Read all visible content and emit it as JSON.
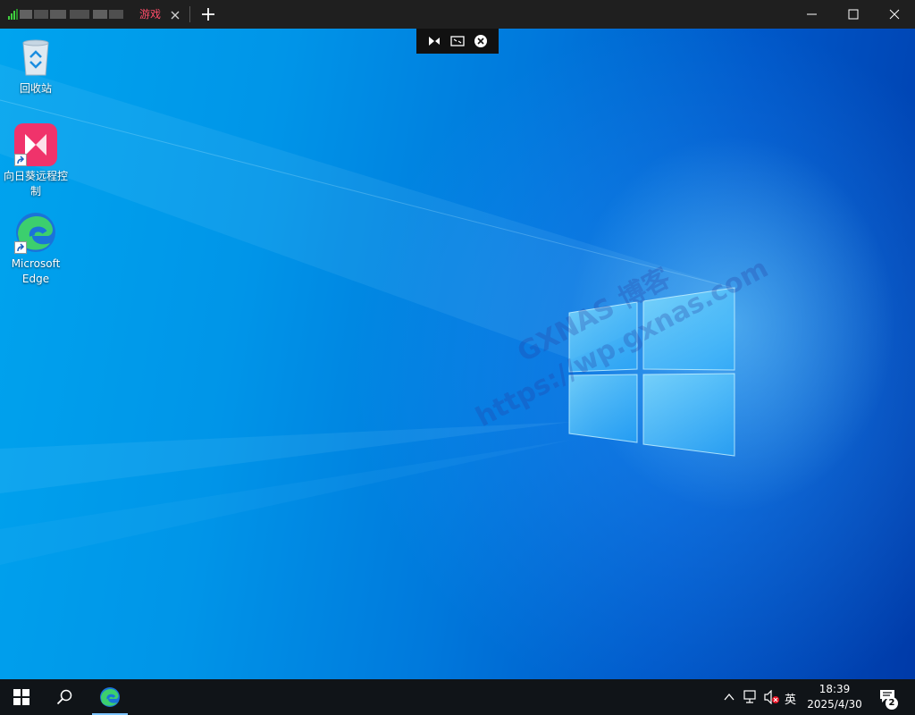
{
  "titlebar": {
    "tab_label": "游戏",
    "tab_label_color": "#ff4d6a",
    "tab_close_icon": "close-icon",
    "new_tab_icon": "plus-icon",
    "window_controls": [
      "minimize-icon",
      "maximize-icon",
      "close-icon"
    ]
  },
  "remote_toolbar": {
    "buttons": [
      "send-keys-icon",
      "fit-screen-icon",
      "disconnect-icon"
    ]
  },
  "desktop": {
    "icons": [
      {
        "label": "回收站",
        "icon": "recycle-bin-icon"
      },
      {
        "label": "向日葵远程控制",
        "icon": "sunlogin-icon"
      },
      {
        "label": "Microsoft Edge",
        "icon": "edge-icon"
      }
    ],
    "watermark_line1": "GXNAS 博客",
    "watermark_line2": "https://wp.gxnas.com"
  },
  "taskbar": {
    "start_icon": "windows-start-icon",
    "search_icon": "search-icon",
    "pinned": [
      "edge-icon"
    ],
    "tray": {
      "chevron": "chevron-up-icon",
      "network": "network-icon",
      "volume": "volume-muted-icon",
      "ime": "英",
      "time": "18:39",
      "date": "2025/4/30",
      "notification_icon": "notification-icon",
      "notification_count": "2"
    }
  },
  "colors": {
    "titlebar": "#1f1f1f",
    "taskbar": "#101418",
    "wallpaper_light": "#00a4ee",
    "wallpaper_dark": "#003aa8",
    "signal": "#3fd13f"
  }
}
